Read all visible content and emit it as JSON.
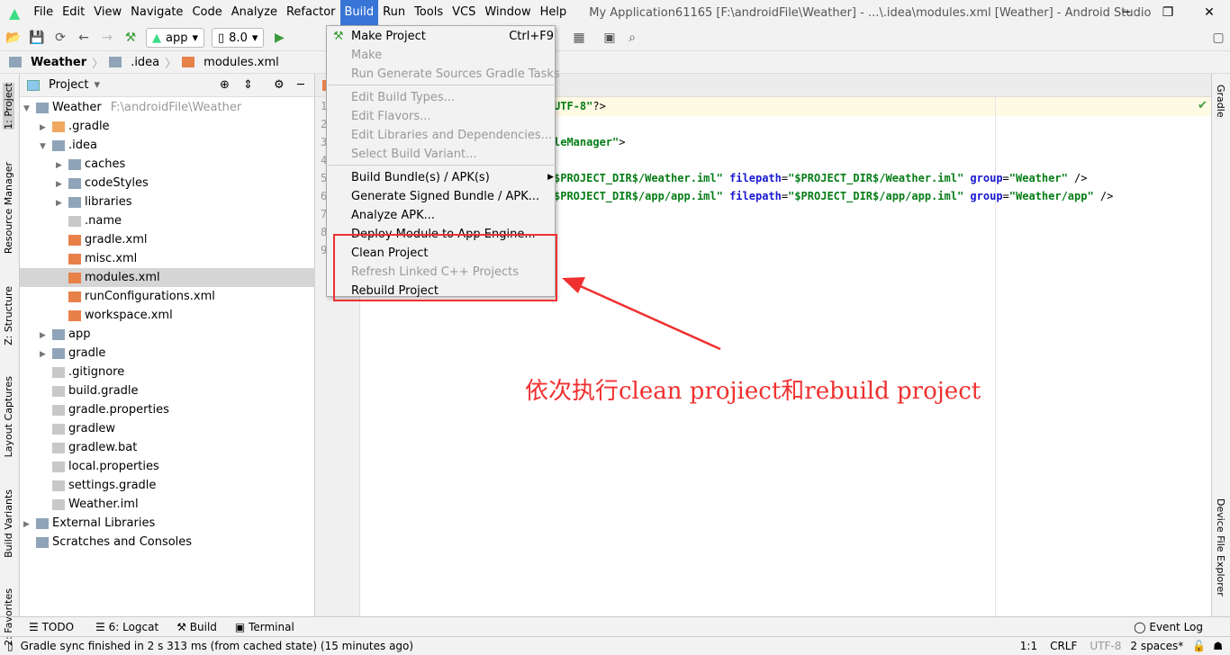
{
  "menubar": {
    "items": [
      "File",
      "Edit",
      "View",
      "Navigate",
      "Code",
      "Analyze",
      "Refactor",
      "Build",
      "Run",
      "Tools",
      "VCS",
      "Window",
      "Help"
    ],
    "active": "Build",
    "title": "My Application61165 [F:\\androidFile\\Weather] - ...\\.idea\\modules.xml [Weather] - Android Studio"
  },
  "toolbar": {
    "config": "app",
    "device": "8.0"
  },
  "breadcrumb": [
    "Weather",
    ".idea",
    "modules.xml"
  ],
  "left_tabs": [
    "1: Project",
    "Resource Manager",
    "Z: Structure",
    "Layout Captures",
    "Build Variants",
    "2: Favorites"
  ],
  "right_tabs": [
    "Gradle",
    "Device File Explorer"
  ],
  "project": {
    "title": "Project",
    "tree": [
      {
        "label": "Weather",
        "hint": "F:\\androidFile\\Weather",
        "level": 0,
        "exp": "open",
        "icon": "module"
      },
      {
        "label": ".gradle",
        "level": 1,
        "exp": "closed",
        "icon": "folder-orange"
      },
      {
        "label": ".idea",
        "level": 1,
        "exp": "open",
        "icon": "folder"
      },
      {
        "label": "caches",
        "level": 2,
        "exp": "closed",
        "icon": "folder"
      },
      {
        "label": "codeStyles",
        "level": 2,
        "exp": "closed",
        "icon": "folder"
      },
      {
        "label": "libraries",
        "level": 2,
        "exp": "closed",
        "icon": "folder"
      },
      {
        "label": ".name",
        "level": 2,
        "icon": "file"
      },
      {
        "label": "gradle.xml",
        "level": 2,
        "icon": "xml"
      },
      {
        "label": "misc.xml",
        "level": 2,
        "icon": "xml"
      },
      {
        "label": "modules.xml",
        "level": 2,
        "icon": "xml",
        "selected": true
      },
      {
        "label": "runConfigurations.xml",
        "level": 2,
        "icon": "xml"
      },
      {
        "label": "workspace.xml",
        "level": 2,
        "icon": "xml"
      },
      {
        "label": "app",
        "level": 1,
        "exp": "closed",
        "icon": "folder"
      },
      {
        "label": "gradle",
        "level": 1,
        "exp": "closed",
        "icon": "folder"
      },
      {
        "label": ".gitignore",
        "level": 1,
        "icon": "file"
      },
      {
        "label": "build.gradle",
        "level": 1,
        "icon": "gradle"
      },
      {
        "label": "gradle.properties",
        "level": 1,
        "icon": "file"
      },
      {
        "label": "gradlew",
        "level": 1,
        "icon": "file"
      },
      {
        "label": "gradlew.bat",
        "level": 1,
        "icon": "file"
      },
      {
        "label": "local.properties",
        "level": 1,
        "icon": "file"
      },
      {
        "label": "settings.gradle",
        "level": 1,
        "icon": "gradle"
      },
      {
        "label": "Weather.iml",
        "level": 1,
        "icon": "file"
      },
      {
        "label": "External Libraries",
        "level": 0,
        "exp": "closed",
        "icon": "library"
      },
      {
        "label": "Scratches and Consoles",
        "level": 0,
        "icon": "scratch"
      }
    ]
  },
  "editor": {
    "line_numbers": [
      "1",
      "2",
      "3",
      "4",
      "5",
      "6",
      "7",
      "8",
      "9"
    ],
    "lines": [
      {
        "n": 1,
        "parts": [
          [
            "str",
            "UTF-8\""
          ],
          [
            "",
            "?>"
          ]
        ]
      },
      {
        "n": 3,
        "parts": [
          [
            "str",
            "leManager\""
          ],
          [
            "",
            ">"
          ]
        ]
      },
      {
        "n": 5,
        "parts": [
          [
            "str",
            "$PROJECT_DIR$/Weather.iml\""
          ],
          [
            "",
            " "
          ],
          [
            "attr",
            "filepath"
          ],
          [
            "",
            "="
          ],
          [
            "str",
            "\"$PROJECT_DIR$/Weather.iml\""
          ],
          [
            "",
            " "
          ],
          [
            "attr",
            "group"
          ],
          [
            "",
            "="
          ],
          [
            "str",
            "\"Weather\""
          ],
          [
            "",
            " />"
          ]
        ]
      },
      {
        "n": 6,
        "parts": [
          [
            "str",
            "$PROJECT_DIR$/app/app.iml\""
          ],
          [
            "",
            " "
          ],
          [
            "attr",
            "filepath"
          ],
          [
            "",
            "="
          ],
          [
            "str",
            "\"$PROJECT_DIR$/app/app.iml\""
          ],
          [
            "",
            " "
          ],
          [
            "attr",
            "group"
          ],
          [
            "",
            "="
          ],
          [
            "str",
            "\"Weather/app\""
          ],
          [
            "",
            " />"
          ]
        ]
      }
    ]
  },
  "build_menu": [
    {
      "label": "Make Project",
      "shortcut": "Ctrl+F9",
      "icon": "hammer-icon"
    },
    {
      "label": "Make",
      "disabled": true
    },
    {
      "label": "Run Generate Sources Gradle Tasks",
      "disabled": true
    },
    {
      "sep": true
    },
    {
      "label": "Edit Build Types...",
      "disabled": true
    },
    {
      "label": "Edit Flavors...",
      "disabled": true
    },
    {
      "label": "Edit Libraries and Dependencies...",
      "disabled": true
    },
    {
      "label": "Select Build Variant...",
      "disabled": true
    },
    {
      "sep": true
    },
    {
      "label": "Build Bundle(s) / APK(s)",
      "submenu": true
    },
    {
      "label": "Generate Signed Bundle / APK..."
    },
    {
      "label": "Analyze APK..."
    },
    {
      "label": "Deploy Module to App Engine..."
    },
    {
      "label": "Clean Project"
    },
    {
      "label": "Refresh Linked C++ Projects",
      "disabled": true
    },
    {
      "label": "Rebuild Project"
    }
  ],
  "annotation": {
    "text": "依次执行clean projiect和rebuild project",
    "color": "#f03030"
  },
  "bottom_tools": [
    "TODO",
    "6: Logcat",
    "Build",
    "Terminal"
  ],
  "event_log": "Event Log",
  "status": {
    "message": "Gradle sync finished in 2 s 313 ms (from cached state) (15 minutes ago)",
    "position": "1:1",
    "line_sep": "CRLF",
    "encoding": "UTF-8",
    "indent": "2 spaces*"
  }
}
